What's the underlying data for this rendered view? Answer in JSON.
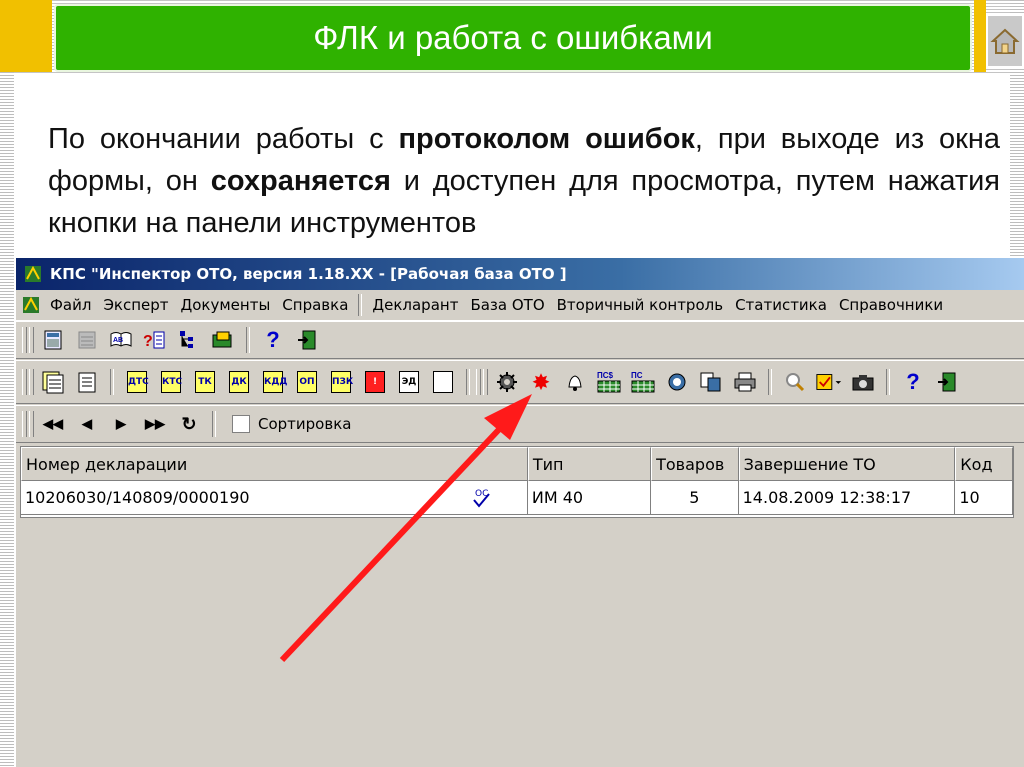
{
  "slide": {
    "title": "ФЛК и работа с ошибками",
    "home_icon": "home-icon",
    "intro": {
      "part1": "По окончании работы с ",
      "bold1": "протоколом ошибок",
      "part2": ",  при выходе из окна формы, он ",
      "bold2": "сохраняется",
      "part3": " и доступен для просмотра, путем нажатия кнопки на панели инструментов"
    }
  },
  "app": {
    "title": "КПС \"Инспектор ОТО, версия 1.18.XX  - [Рабочая база ОТО ]",
    "menu": [
      "Файл",
      "Эксперт",
      "Документы",
      "Справка",
      "Декларант",
      "База ОТО",
      "Вторичный контроль",
      "Статистика",
      "Справочники"
    ],
    "toolbar2_docs": [
      "ДТС",
      "КТС",
      "ТК",
      "ДК",
      "КДД",
      "ОП",
      "ПЗК",
      "!",
      "ЭД",
      ""
    ],
    "toolbar2_badges": [
      "ПС$",
      "ПС"
    ],
    "nav": {
      "sort_label": "Сортировка"
    },
    "grid": {
      "headers": [
        "Номер декларации",
        "Тип",
        "Товаров",
        "Завершение ТО",
        "Код"
      ],
      "rows": [
        [
          "10206030/140809/0000190",
          "ИМ 40",
          "5",
          "14.08.2009 12:38:17",
          "10"
        ]
      ],
      "row_status_icon": "check-icon",
      "row_badge": "ОС"
    }
  },
  "colors": {
    "title_green": "#2fb200",
    "accent_yellow": "#f1c000",
    "arrow_red": "#ff1a1a"
  }
}
